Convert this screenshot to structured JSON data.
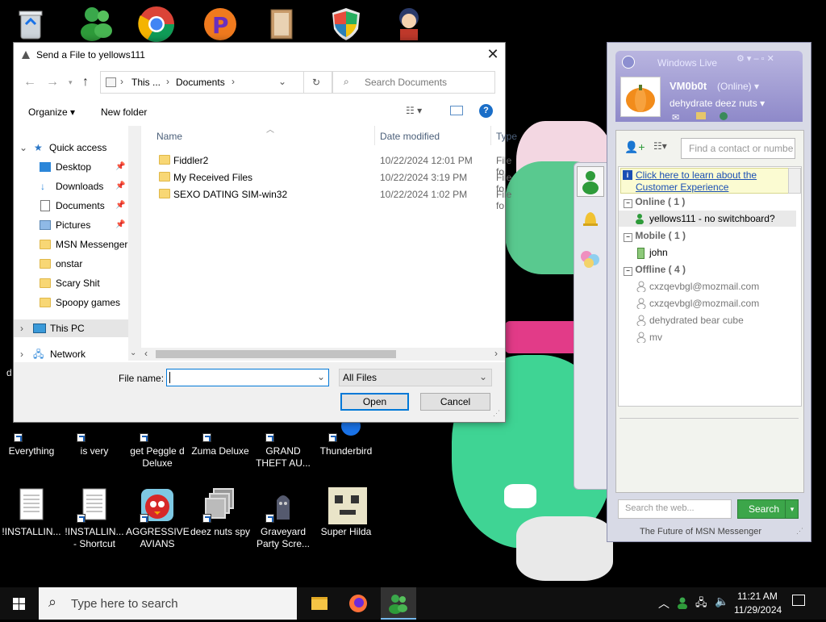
{
  "desktop": {
    "top_icons": [
      {
        "name": "recycle-bin-icon"
      },
      {
        "name": "messenger-icon"
      },
      {
        "name": "chrome-icon"
      },
      {
        "name": "peggle-icon"
      },
      {
        "name": "document-icon"
      },
      {
        "name": "shield-icon"
      },
      {
        "name": "character-icon"
      }
    ],
    "icons_row1": [
      {
        "label": "Everything"
      },
      {
        "label": "is very"
      },
      {
        "label": "get Peggle d Deluxe"
      },
      {
        "label": "Zuma Deluxe"
      },
      {
        "label": "GRAND THEFT AU..."
      },
      {
        "label": "Thunderbird"
      }
    ],
    "icons_row2": [
      {
        "label": "!INSTALLIN..."
      },
      {
        "label": "!INSTALLIN... - Shortcut"
      },
      {
        "label": "AGGRESSIVE AVIANS"
      },
      {
        "label": "deez nuts spy"
      },
      {
        "label": "Graveyard Party Scre..."
      },
      {
        "label": "Super Hilda"
      }
    ],
    "left_clip_label": "d"
  },
  "dialog": {
    "title": "Send a File to yellows111",
    "address_parts": [
      "This ...",
      "Documents"
    ],
    "search_placeholder": "Search Documents",
    "organize_label": "Organize",
    "new_folder_label": "New folder",
    "nav_items": [
      {
        "label": "Quick access"
      },
      {
        "label": "Desktop"
      },
      {
        "label": "Downloads"
      },
      {
        "label": "Documents"
      },
      {
        "label": "Pictures"
      },
      {
        "label": "MSN Messenger"
      },
      {
        "label": "onstar"
      },
      {
        "label": "Scary Shit"
      },
      {
        "label": "Spoopy games"
      },
      {
        "label": "This PC"
      },
      {
        "label": "Network"
      }
    ],
    "columns": {
      "name": "Name",
      "date": "Date modified",
      "type": "Type"
    },
    "files": [
      {
        "name": "Fiddler2",
        "date": "10/22/2024 12:01 PM",
        "type": "File fo"
      },
      {
        "name": "My Received Files",
        "date": "10/22/2024 3:19 PM",
        "type": "File fo"
      },
      {
        "name": "SEXO DATING SIM-win32",
        "date": "10/22/2024 1:02 PM",
        "type": "File fo"
      }
    ],
    "filename_label": "File name:",
    "filename_value": "",
    "filter_value": "All Files",
    "open_label": "Open",
    "cancel_label": "Cancel"
  },
  "messenger": {
    "title": "Windows Live",
    "user_name": "VM0b0t",
    "status": "(Online)",
    "personal_message": "dehydrate deez nuts",
    "find_placeholder": "Find a contact or numbe",
    "info_link": "Click here to learn about the Customer Experience",
    "groups": [
      {
        "label": "Online ( 1 )",
        "contacts": [
          {
            "name": "yellows111 - no switchboard?",
            "state": "online"
          }
        ]
      },
      {
        "label": "Mobile ( 1 )",
        "contacts": [
          {
            "name": "john",
            "state": "mobile"
          }
        ]
      },
      {
        "label": "Offline ( 4 )",
        "contacts": [
          {
            "name": "cxzqevbgl@mozmail.com",
            "state": "offline"
          },
          {
            "name": "cxzqevbgl@mozmail.com",
            "state": "offline"
          },
          {
            "name": "dehydrated bear cube",
            "state": "offline"
          },
          {
            "name": "mv",
            "state": "offline"
          }
        ]
      }
    ],
    "search_web_placeholder": "Search the web...",
    "search_button": "Search",
    "footer": "The Future of MSN Messenger"
  },
  "taskbar": {
    "search_placeholder": "Type here to search",
    "time": "11:21 AM",
    "date": "11/29/2024"
  },
  "colors": {
    "accent_blue": "#0078d7",
    "msn_green": "#2e9b3a",
    "wallpaper_green": "#3fd494",
    "wallpaper_pink": "#e23b88"
  }
}
